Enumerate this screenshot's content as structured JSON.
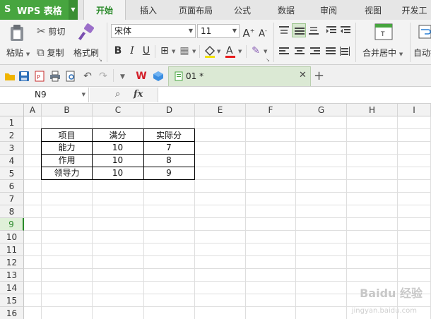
{
  "app": {
    "name": "WPS 表格",
    "logo": "S"
  },
  "menu": [
    "开始",
    "插入",
    "页面布局",
    "公式",
    "数据",
    "审阅",
    "视图",
    "开发工"
  ],
  "ribbon": {
    "paste": "粘贴",
    "cut": "剪切",
    "copy": "复制",
    "format_painter": "格式刷",
    "font_name": "宋体",
    "font_size": "11",
    "merge_center": "合并居中",
    "auto_wrap": "自动换"
  },
  "doc_tab": {
    "name": "01 *"
  },
  "namebox": {
    "value": "N9"
  },
  "fx_label": "fx",
  "columns": [
    "A",
    "B",
    "C",
    "D",
    "E",
    "F",
    "G",
    "H",
    "I"
  ],
  "rows": [
    "1",
    "2",
    "3",
    "4",
    "5",
    "6",
    "7",
    "8",
    "9",
    "10",
    "11",
    "12",
    "13",
    "14",
    "15",
    "16"
  ],
  "selected_row": "9",
  "table": {
    "header": [
      "项目",
      "满分",
      "实际分"
    ],
    "rows": [
      [
        "能力",
        "10",
        "7"
      ],
      [
        "作用",
        "10",
        "8"
      ],
      [
        "领导力",
        "10",
        "9"
      ]
    ]
  },
  "watermark": {
    "main": "Baidu 经验",
    "sub": "jingyan.baidu.com"
  },
  "colors": {
    "accent": "#47a53f",
    "active_tab_text": "#2a8a2a"
  }
}
